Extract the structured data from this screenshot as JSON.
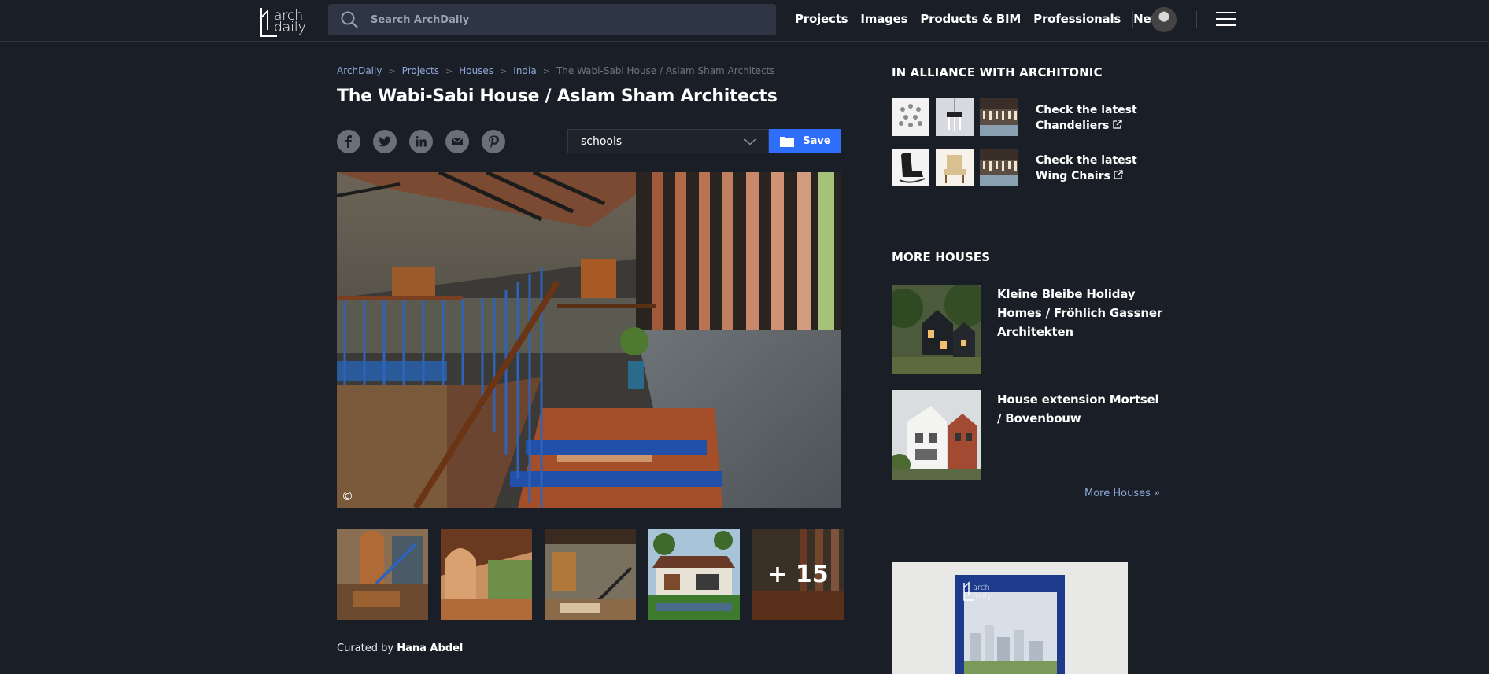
{
  "header": {
    "logo_line1": "arch",
    "logo_line2": "daily",
    "search_placeholder": "Search ArchDaily",
    "nav": [
      "Projects",
      "Images",
      "Products & BIM",
      "Professionals",
      "News"
    ]
  },
  "breadcrumb": [
    "ArchDaily",
    "Projects",
    "Houses",
    "India",
    "The Wabi-Sabi House / Aslam Sham Architects"
  ],
  "title": "The Wabi-Sabi House / Aslam Sham Architects",
  "share": [
    "facebook",
    "twitter",
    "linkedin",
    "email",
    "pinterest"
  ],
  "folder": {
    "selected": "schools"
  },
  "save_label": "Save",
  "photo": {
    "copyright_symbol": "©"
  },
  "thumbnails": {
    "more_count": "+ 15"
  },
  "curated": {
    "prefix": "Curated by",
    "name": "Hana Abdel"
  },
  "sidebar": {
    "alliance_heading": "IN ALLIANCE WITH ARCHITONIC",
    "alliance": [
      {
        "label": "Check the latest Chandeliers"
      },
      {
        "label": "Check the latest Wing Chairs"
      }
    ],
    "more_heading": "MORE HOUSES",
    "houses": [
      {
        "title": "Kleine Bleibe Holiday Homes / Fröhlich Gassner Architekten"
      },
      {
        "title": "House extension Mortsel / Bovenbouw"
      }
    ],
    "more_link": "More Houses »"
  },
  "ad": {
    "logo_line1": "arch",
    "logo_line2": "daily"
  },
  "colors": {
    "background": "#1a1f27",
    "accent": "#2f6dfb",
    "link": "#8ea8d9"
  }
}
